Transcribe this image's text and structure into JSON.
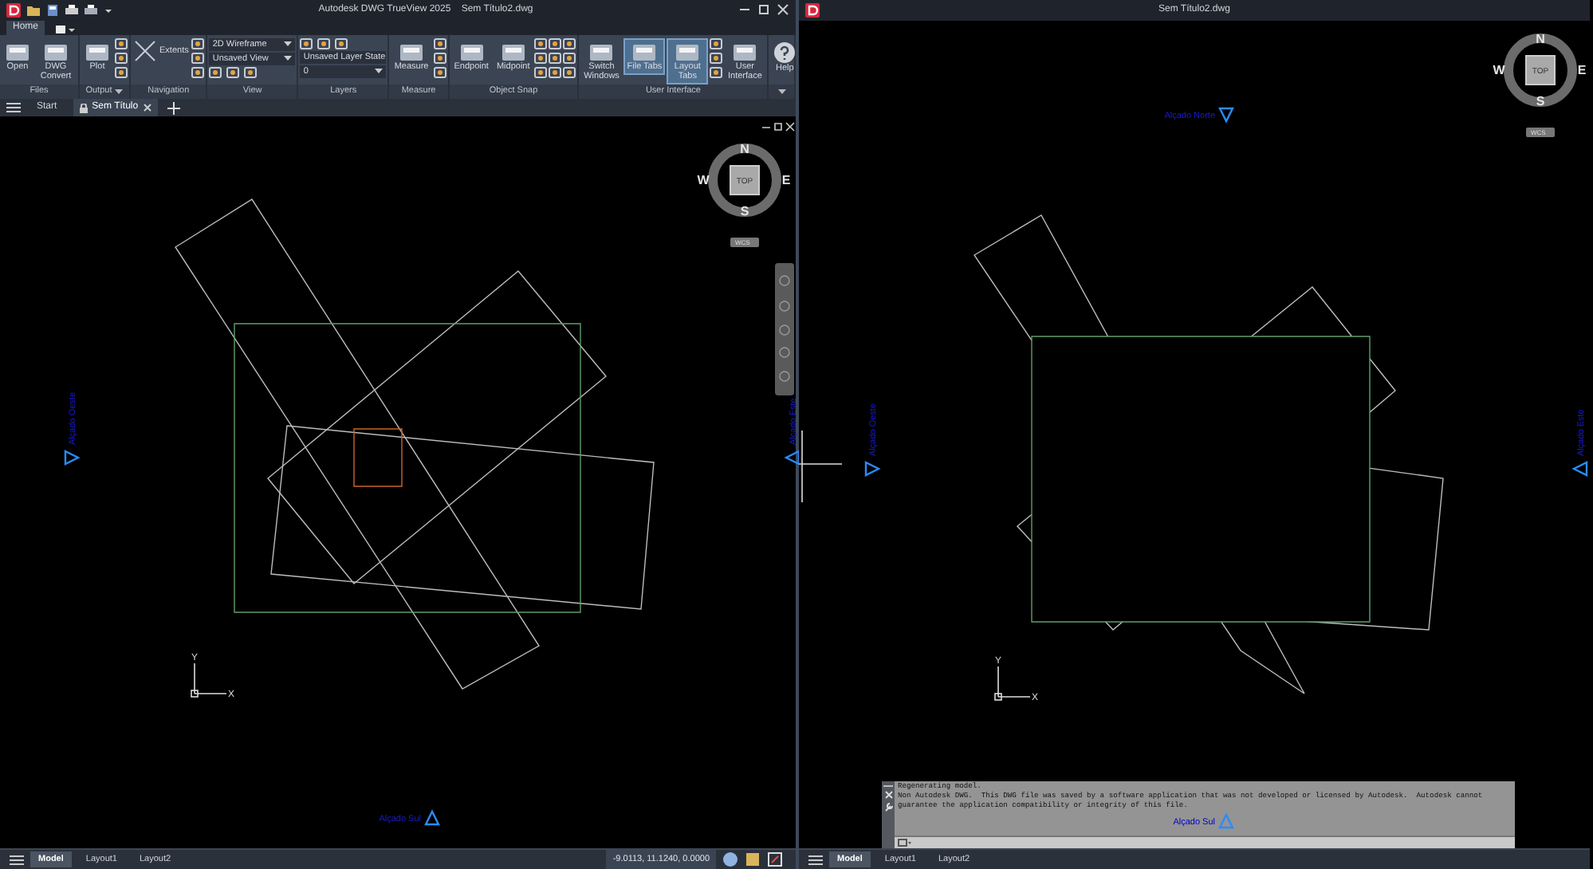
{
  "left_window": {
    "title": "Autodesk DWG TrueView 2025",
    "document": "Sem Título2.dwg",
    "ribbon_tabs": [
      {
        "label": "Home",
        "selected": true
      }
    ],
    "panels": [
      {
        "title": "Files",
        "tools": [
          {
            "kind": "large",
            "label": "Open"
          },
          {
            "kind": "large",
            "label": "DWG Convert"
          }
        ]
      },
      {
        "title": "Output",
        "has_menu": true,
        "tools": [
          {
            "kind": "large",
            "label": "Plot"
          },
          {
            "kind": "icons"
          }
        ]
      },
      {
        "title": "Navigation",
        "tools": [
          {
            "kind": "inline",
            "label": "Extents"
          },
          {
            "kind": "icons"
          }
        ]
      },
      {
        "title": "View",
        "tools": [
          {
            "kind": "dropdown",
            "label": "2D Wireframe"
          },
          {
            "kind": "dropdown",
            "label": "Unsaved View"
          },
          {
            "kind": "iconrow"
          }
        ]
      },
      {
        "title": "Layers",
        "tools": [
          {
            "kind": "iconrow"
          },
          {
            "kind": "dropdown",
            "label": "Unsaved Layer State"
          },
          {
            "kind": "dropdown",
            "label": "0"
          }
        ]
      },
      {
        "title": "Measure",
        "tools": [
          {
            "kind": "large",
            "label": "Measure"
          },
          {
            "kind": "icons"
          }
        ]
      },
      {
        "title": "Object Snap",
        "tools": [
          {
            "kind": "large",
            "label": "Endpoint"
          },
          {
            "kind": "large",
            "label": "Midpoint"
          },
          {
            "kind": "icons"
          },
          {
            "kind": "icons"
          },
          {
            "kind": "icons"
          }
        ]
      },
      {
        "title": "User Interface",
        "tools": [
          {
            "kind": "large",
            "label": "Switch Windows",
            "selected": false
          },
          {
            "kind": "large",
            "label": "File Tabs",
            "selected": true
          },
          {
            "kind": "large",
            "label": "Layout Tabs",
            "selected": true
          },
          {
            "kind": "icons"
          },
          {
            "kind": "large",
            "label": "User Interface",
            "selected": false
          }
        ]
      },
      {
        "has_menu": true,
        "tools": [
          {
            "kind": "help",
            "label": "Help"
          }
        ]
      }
    ],
    "file_tabs": [
      {
        "label": "Start",
        "selected": false
      },
      {
        "label": "Sem Título",
        "selected": true
      }
    ],
    "viewcube": {
      "north": "N",
      "south": "S",
      "east": "E",
      "west": "W",
      "face": "TOP",
      "ucs": "WCS"
    },
    "ucs_axes": {
      "x": "X",
      "y": "Y"
    },
    "elevation_labels": [
      {
        "kind": "west",
        "text": "Alçado Oeste"
      },
      {
        "kind": "east",
        "text": "Alçado Este"
      },
      {
        "kind": "south",
        "text": "Alçado Sul"
      }
    ],
    "layout_tabs": [
      {
        "label": "Model",
        "selected": true
      },
      {
        "label": "Layout1",
        "selected": false
      },
      {
        "label": "Layout2",
        "selected": false
      }
    ],
    "coordinates": "-9.0113, 11.1240, 0.0000"
  },
  "right_window": {
    "title": "Sem Título2.dwg",
    "viewcube": {
      "north": "N",
      "south": "S",
      "east": "E",
      "west": "W",
      "face": "TOP",
      "ucs": "WCS"
    },
    "ucs_axes": {
      "x": "X",
      "y": "Y"
    },
    "elevation_labels": [
      {
        "kind": "north",
        "text": "Alçado Norte"
      },
      {
        "kind": "west",
        "text": "Alçado Oeste"
      },
      {
        "kind": "east",
        "text": "Alçado Este"
      },
      {
        "kind": "south",
        "text": "Alçado Sul"
      }
    ],
    "command_history": [
      "Regenerating model.",
      "Non Autodesk DWG.  This DWG file was saved by a software application that was not developed or licensed by Autodesk.  Autodesk cannot",
      "guarantee the application compatibility or integrity of this file."
    ],
    "layout_tabs": [
      {
        "label": "Model",
        "selected": true
      },
      {
        "label": "Layout1",
        "selected": false
      },
      {
        "label": "Layout2",
        "selected": false
      }
    ]
  }
}
